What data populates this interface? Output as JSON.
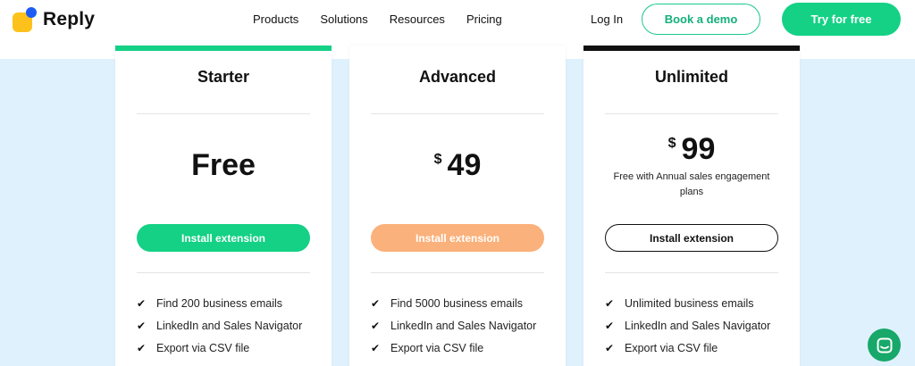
{
  "header": {
    "brand": "Reply",
    "nav": [
      "Products",
      "Solutions",
      "Resources",
      "Pricing"
    ],
    "login": "Log In",
    "book_demo": "Book a demo",
    "try_free": "Try for free"
  },
  "colors": {
    "green": "#14d185",
    "orange": "#fbb17b",
    "black": "#111111",
    "blue_bg": "#dff1fd"
  },
  "plans": [
    {
      "name": "Starter",
      "price": "Free",
      "cta": "Install extension",
      "features": [
        "Find 200 business emails",
        "LinkedIn and Sales Navigator",
        "Export via CSV file"
      ]
    },
    {
      "name": "Advanced",
      "currency": "$",
      "price": "49",
      "cta": "Install extension",
      "features": [
        "Find 5000 business emails",
        "LinkedIn and Sales Navigator",
        "Export via CSV file"
      ]
    },
    {
      "name": "Unlimited",
      "currency": "$",
      "price": "99",
      "note": "Free with Annual sales engagement plans",
      "cta": "Install extension",
      "features": [
        "Unlimited business emails",
        "LinkedIn and Sales Navigator",
        "Export via CSV file"
      ]
    }
  ],
  "icons": {
    "check": "check-icon",
    "chat": "chat-icon"
  }
}
